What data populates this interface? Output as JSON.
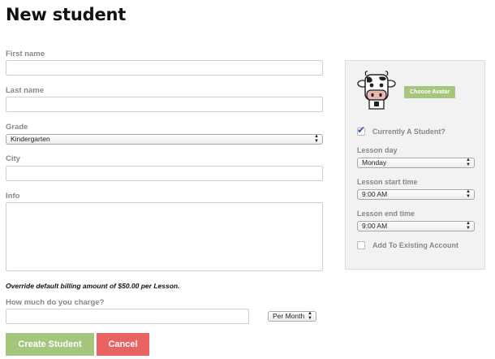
{
  "page": {
    "title": "New student"
  },
  "form": {
    "first_name": {
      "label": "First name",
      "value": ""
    },
    "last_name": {
      "label": "Last name",
      "value": ""
    },
    "grade": {
      "label": "Grade",
      "value": "Kindergarten"
    },
    "city": {
      "label": "City",
      "value": ""
    },
    "info": {
      "label": "Info",
      "value": ""
    },
    "billing_note": "Override default billing amount of $50.00 per Lesson.",
    "charge": {
      "label": "How much do you charge?",
      "value": "",
      "period": "Per Month"
    }
  },
  "sidebar": {
    "choose_avatar": "Choose Avatar",
    "currently_student": {
      "label": "Currently A Student?",
      "checked": true
    },
    "lesson_day": {
      "label": "Lesson day",
      "value": "Monday"
    },
    "lesson_start": {
      "label": "Lesson start time",
      "value": "9:00 AM"
    },
    "lesson_end": {
      "label": "Lesson end time",
      "value": "9:00 AM"
    },
    "existing_account": {
      "label": "Add To Existing Account",
      "checked": false
    }
  },
  "actions": {
    "create": "Create Student",
    "cancel": "Cancel"
  },
  "colors": {
    "accent_green": "#a6c680",
    "cancel_red": "#e96362",
    "check_blue": "#2c57a7"
  },
  "icons": {
    "avatar": "cow-avatar-icon",
    "select": "select-arrows-icon"
  }
}
